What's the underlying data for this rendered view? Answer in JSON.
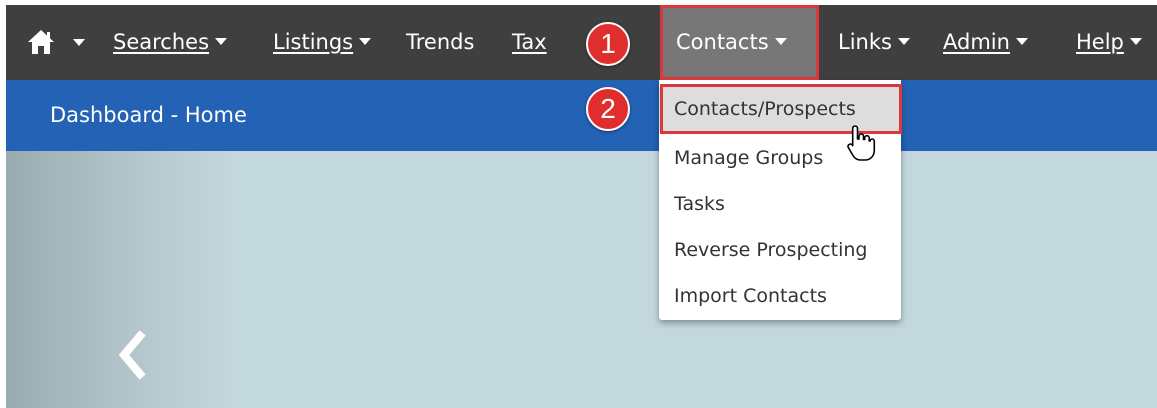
{
  "nav": {
    "searches": "Searches",
    "listings": "Listings",
    "trends": "Trends",
    "tax": "Tax",
    "contacts": "Contacts",
    "links": "Links",
    "admin": "Admin",
    "help": "Help"
  },
  "banner": {
    "title": "Dashboard - Home"
  },
  "dropdown": {
    "items": [
      "Contacts/Prospects",
      "Manage Groups",
      "Tasks",
      "Reverse Prospecting",
      "Import Contacts"
    ]
  },
  "callouts": {
    "step1": "1",
    "step2": "2"
  },
  "icons": {
    "home": "home-icon",
    "caret": "caret-down-icon",
    "carousel_prev": "chevron-left-icon",
    "pointer": "hand-cursor-icon"
  },
  "colors": {
    "nav_bg": "#3f3f3f",
    "active_bg": "#777777",
    "banner_bg": "#2362b4",
    "callout": "#e02d2d"
  }
}
